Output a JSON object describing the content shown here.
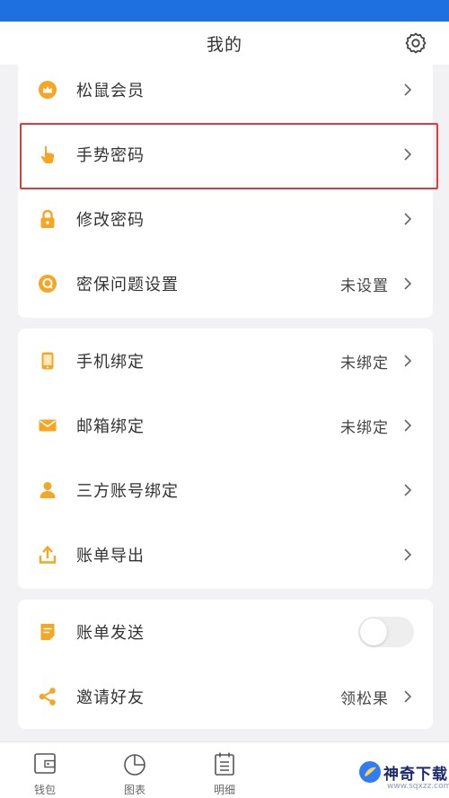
{
  "header": {
    "title": "我的",
    "settings_icon": "gear-icon"
  },
  "section1": [
    {
      "label": "松鼠会员",
      "value": "",
      "icon": "crown-icon"
    },
    {
      "label": "手势密码",
      "value": "",
      "icon": "hand-pointer-icon"
    },
    {
      "label": "修改密码",
      "value": "",
      "icon": "lock-icon"
    },
    {
      "label": "密保问题设置",
      "value": "未设置",
      "icon": "question-badge-icon"
    }
  ],
  "section2": [
    {
      "label": "手机绑定",
      "value": "未绑定",
      "icon": "phone-icon"
    },
    {
      "label": "邮箱绑定",
      "value": "未绑定",
      "icon": "mail-icon"
    },
    {
      "label": "三方账号绑定",
      "value": "",
      "icon": "user-icon"
    },
    {
      "label": "账单导出",
      "value": "",
      "icon": "upload-icon"
    }
  ],
  "section3": [
    {
      "label": "账单发送",
      "toggle_on": false,
      "icon": "bill-icon"
    },
    {
      "label": "邀请好友",
      "value": "领松果",
      "icon": "share-icon"
    }
  ],
  "tabbar": [
    {
      "label": "钱包",
      "icon": "wallet-icon"
    },
    {
      "label": "图表",
      "icon": "pie-chart-icon"
    },
    {
      "label": "明细",
      "icon": "list-icon"
    }
  ],
  "watermark": {
    "text": "神奇下载",
    "url": "www.sqxzz.com"
  },
  "colors": {
    "accent": "#f5a623",
    "status_bar": "#1e6fe0",
    "highlight": "#e03b3b"
  }
}
